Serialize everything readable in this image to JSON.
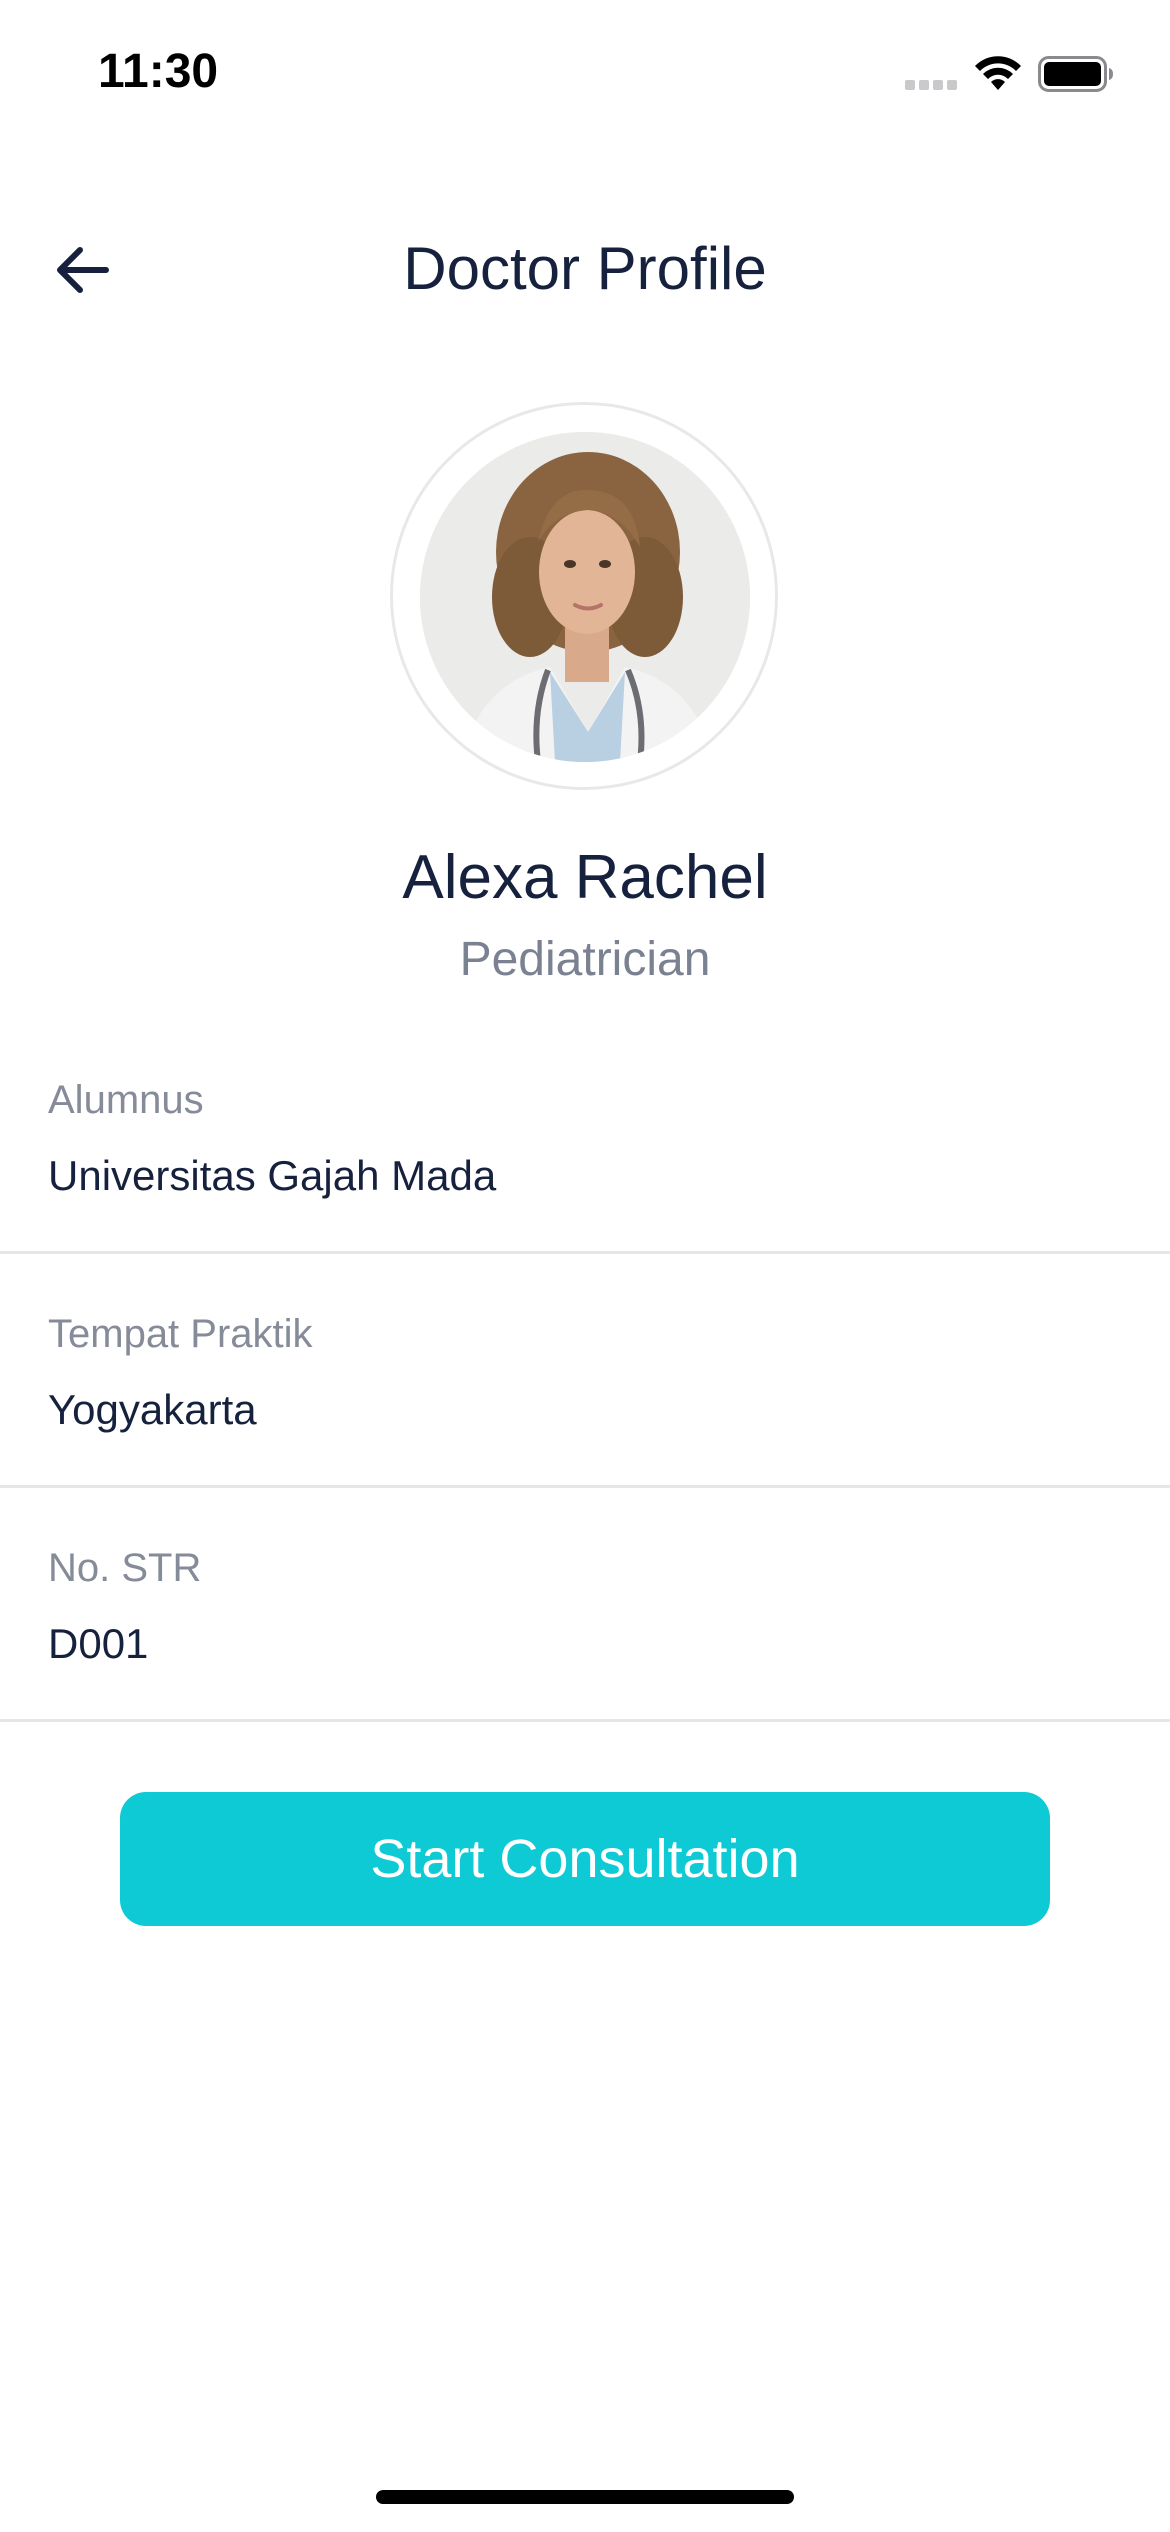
{
  "status_bar": {
    "time": "11:30",
    "icons": [
      "cellular-signal-icon",
      "wifi-icon",
      "battery-icon"
    ]
  },
  "header": {
    "title": "Doctor Profile",
    "back_icon": "arrow-left-icon"
  },
  "doctor": {
    "name": "Alexa Rachel",
    "specialty": "Pediatrician"
  },
  "info": [
    {
      "label": "Alumnus",
      "value": "Universitas Gajah Mada"
    },
    {
      "label": "Tempat Praktik",
      "value": "Yogyakarta"
    },
    {
      "label": "No. STR",
      "value": "D001"
    }
  ],
  "actions": {
    "start_label": "Start Consultation"
  },
  "colors": {
    "accent": "#0ecad4",
    "text_primary": "#16223d",
    "text_secondary": "#7a8292",
    "divider": "#e6e6e8"
  }
}
